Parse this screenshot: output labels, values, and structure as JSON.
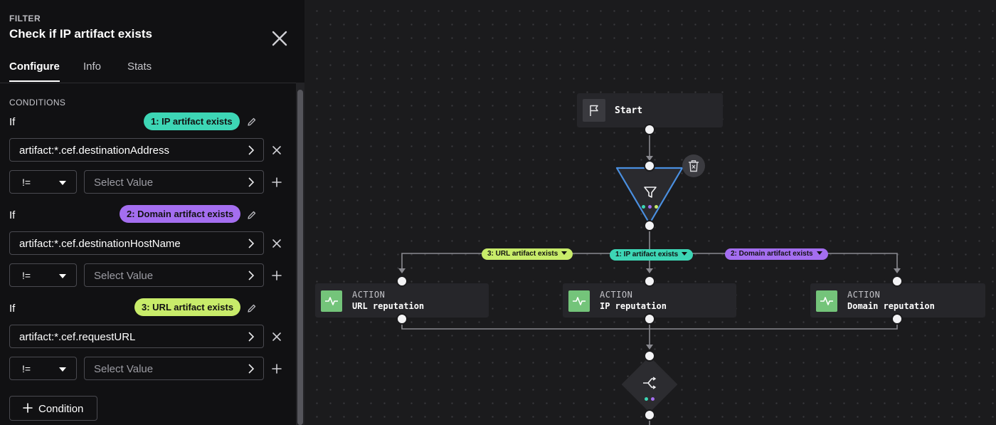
{
  "panel": {
    "eyebrow": "FILTER",
    "title": "Check if IP artifact exists",
    "tabs": [
      {
        "label": "Configure",
        "active": true
      },
      {
        "label": "Info",
        "active": false
      },
      {
        "label": "Stats",
        "active": false
      }
    ],
    "section_header": "CONDITIONS",
    "conditions": [
      {
        "if_label": "If",
        "chip": "1: IP artifact exists",
        "chip_color": "#3dd6b5",
        "field": "artifact:*.cef.destinationAddress",
        "operator": "!=",
        "value_placeholder": "Select Value"
      },
      {
        "if_label": "If",
        "chip": "2: Domain artifact exists",
        "chip_color": "#a46ef0",
        "field": "artifact:*.cef.destinationHostName",
        "operator": "!=",
        "value_placeholder": "Select Value"
      },
      {
        "if_label": "If",
        "chip": "3: URL artifact exists",
        "chip_color": "#c8ec6a",
        "field": "artifact:*.cef.requestURL",
        "operator": "!=",
        "value_placeholder": "Select Value"
      }
    ],
    "add_condition_label": "Condition"
  },
  "canvas": {
    "start_label": "Start",
    "edge_labels": [
      {
        "label": "3: URL artifact exists",
        "color": "#c8ec6a"
      },
      {
        "label": "1: IP artifact exists",
        "color": "#3dd6b5"
      },
      {
        "label": "2: Domain artifact exists",
        "color": "#a46ef0"
      }
    ],
    "actions": [
      {
        "type_label": "ACTION",
        "name": "URL reputation"
      },
      {
        "type_label": "ACTION",
        "name": "IP reputation"
      },
      {
        "type_label": "ACTION",
        "name": "Domain reputation"
      }
    ],
    "colors": {
      "accent_selected": "#4a8fe0",
      "action_green": "#74c47a"
    },
    "icons": [
      "flag-icon",
      "funnel-icon",
      "trash-icon",
      "pulse-icon",
      "merge-icon",
      "close-icon",
      "pencil-icon",
      "chevron-right-icon",
      "plus-icon",
      "caret-down-icon"
    ]
  }
}
